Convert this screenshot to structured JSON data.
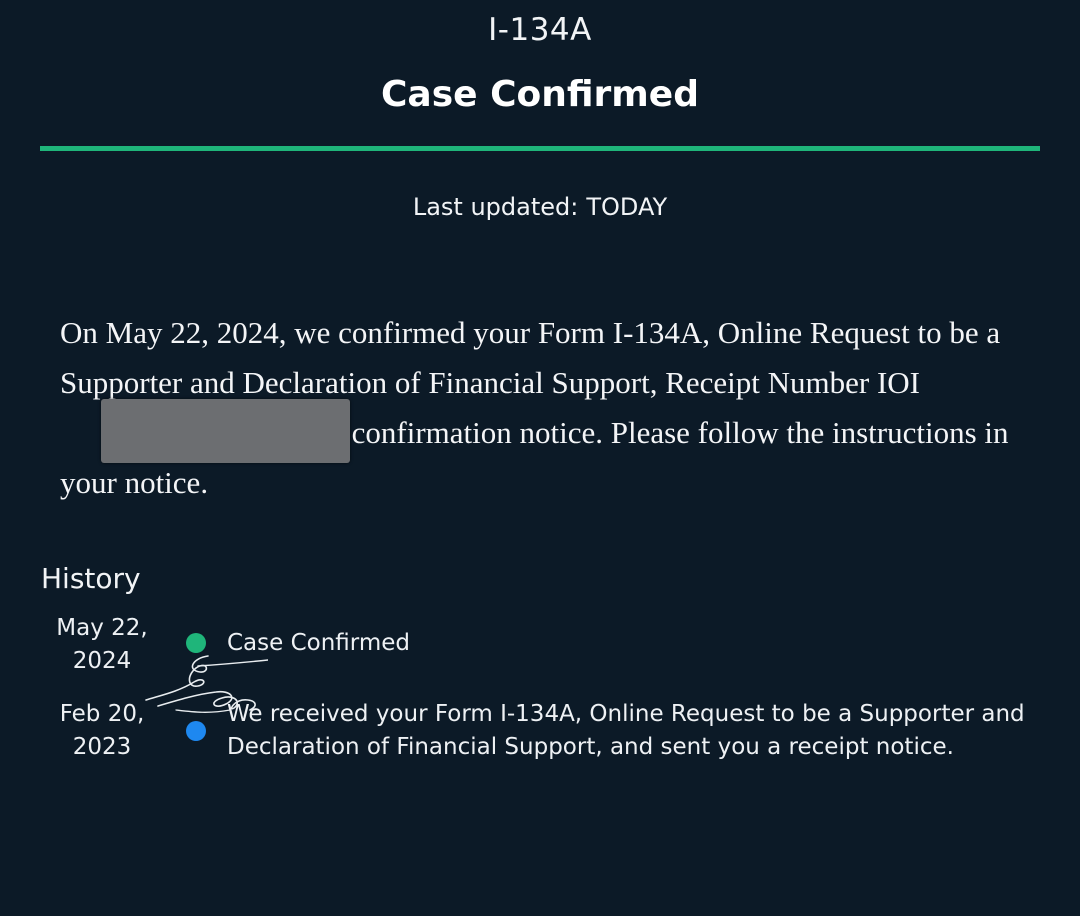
{
  "header": {
    "form_id": "I-134A",
    "case_status": "Case Confirmed",
    "accent_color": "#1fb57a",
    "last_updated_label": "Last updated:",
    "last_updated_value": "TODAY"
  },
  "description": {
    "before_redaction": "On May 22, 2024, we confirmed your Form I-134A, Online Request to be a Supporter and Declaration of Financial Support, Receipt Number IOI",
    "after_redaction": "emailed you a confirmation notice. Please follow the instructions in your notice."
  },
  "history": {
    "title": "History",
    "events": [
      {
        "date_line1": "May 22,",
        "date_line2": "2024",
        "text": "Case Confirmed",
        "dot_color": "#1fb57a"
      },
      {
        "date_line1": "Feb 20,",
        "date_line2": "2023",
        "text": "We received your Form I-134A, Online Request to be a Supporter and Declaration of Financial Support, and sent you a receipt notice.",
        "dot_color": "#1e88f0"
      }
    ]
  }
}
